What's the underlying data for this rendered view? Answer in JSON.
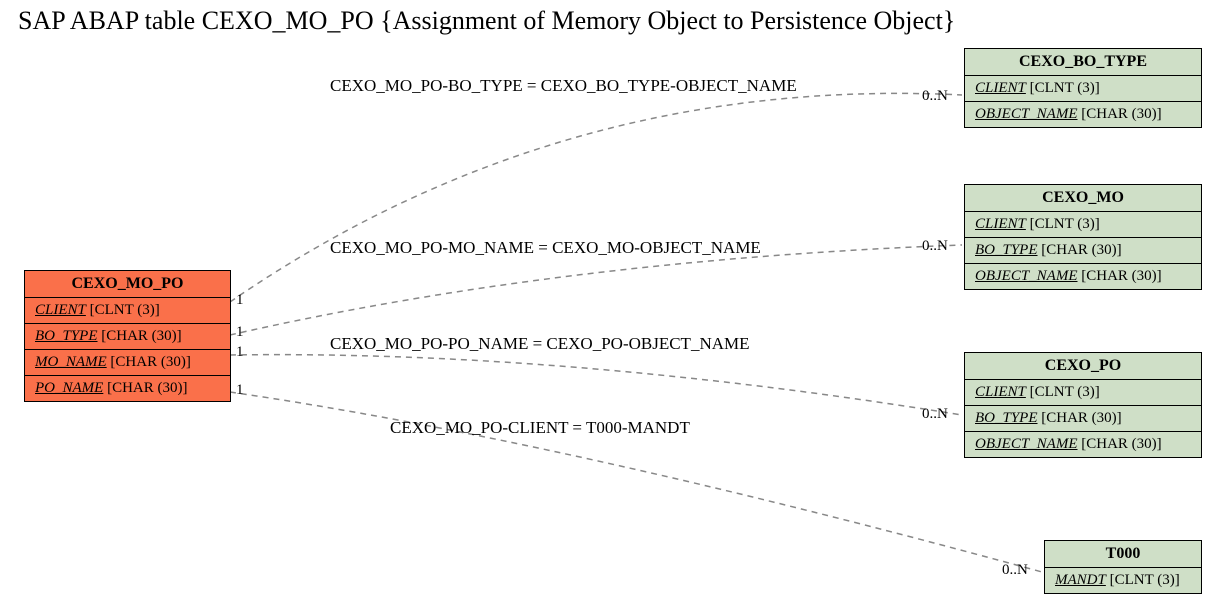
{
  "title": "SAP ABAP table CEXO_MO_PO {Assignment of Memory Object to Persistence Object}",
  "main_table": {
    "name": "CEXO_MO_PO",
    "fields": [
      {
        "name": "CLIENT",
        "type": "[CLNT (3)]"
      },
      {
        "name": "BO_TYPE",
        "type": "[CHAR (30)]"
      },
      {
        "name": "MO_NAME",
        "type": "[CHAR (30)]"
      },
      {
        "name": "PO_NAME",
        "type": "[CHAR (30)]"
      }
    ]
  },
  "related_tables": [
    {
      "name": "CEXO_BO_TYPE",
      "fields": [
        {
          "name": "CLIENT",
          "type": "[CLNT (3)]"
        },
        {
          "name": "OBJECT_NAME",
          "type": "[CHAR (30)]"
        }
      ]
    },
    {
      "name": "CEXO_MO",
      "fields": [
        {
          "name": "CLIENT",
          "type": "[CLNT (3)]"
        },
        {
          "name": "BO_TYPE",
          "type": "[CHAR (30)]"
        },
        {
          "name": "OBJECT_NAME",
          "type": "[CHAR (30)]"
        }
      ]
    },
    {
      "name": "CEXO_PO",
      "fields": [
        {
          "name": "CLIENT",
          "type": "[CLNT (3)]"
        },
        {
          "name": "BO_TYPE",
          "type": "[CHAR (30)]"
        },
        {
          "name": "OBJECT_NAME",
          "type": "[CHAR (30)]"
        }
      ]
    },
    {
      "name": "T000",
      "fields": [
        {
          "name": "MANDT",
          "type": "[CLNT (3)]"
        }
      ]
    }
  ],
  "relationships": [
    {
      "label": "CEXO_MO_PO-BO_TYPE = CEXO_BO_TYPE-OBJECT_NAME",
      "left_card": "1",
      "right_card": "0..N"
    },
    {
      "label": "CEXO_MO_PO-MO_NAME = CEXO_MO-OBJECT_NAME",
      "left_card": "1",
      "right_card": "0..N"
    },
    {
      "label": "CEXO_MO_PO-PO_NAME = CEXO_PO-OBJECT_NAME",
      "left_card": "1",
      "right_card": "0..N"
    },
    {
      "label": "CEXO_MO_PO-CLIENT = T000-MANDT",
      "left_card": "1",
      "right_card": "0..N"
    }
  ]
}
